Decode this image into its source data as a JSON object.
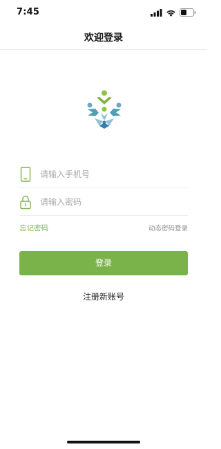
{
  "status_bar": {
    "time": "7:45",
    "icons": [
      "signal-icon",
      "wifi-icon",
      "battery-icon"
    ]
  },
  "nav": {
    "title": "欢迎登录"
  },
  "logo": {
    "icon": "app-logo-icon",
    "colors": {
      "green": "#8cc63f",
      "teal": "#4f9fb8",
      "blue": "#3a7ca8",
      "light_blue": "#8fc3d9"
    }
  },
  "form": {
    "phone": {
      "icon": "phone-icon",
      "placeholder": "请输入手机号",
      "value": ""
    },
    "password": {
      "icon": "lock-icon",
      "placeholder": "请输入密码",
      "value": ""
    }
  },
  "links": {
    "forgot_password": "忘记密码",
    "dynamic_login": "动态密码登录",
    "register": "注册新账号"
  },
  "login_button": {
    "label": "登录"
  },
  "colors": {
    "accent": "#7ab34a",
    "placeholder": "#a8a8a8",
    "secondary_text": "#8c8c8c"
  }
}
